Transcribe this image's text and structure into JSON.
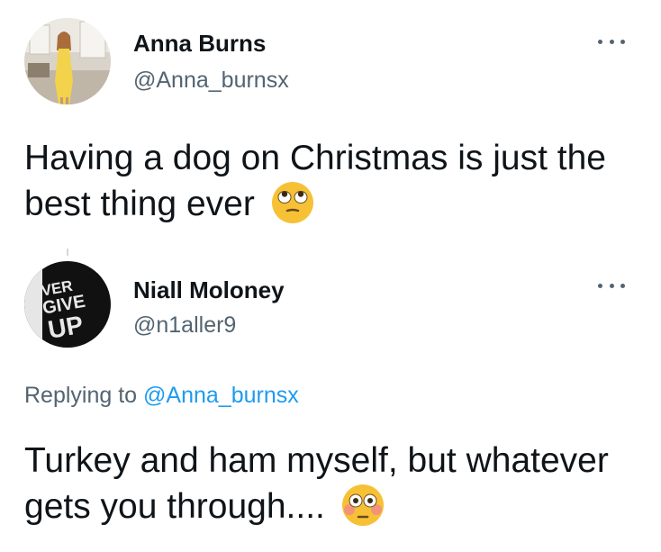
{
  "tweet1": {
    "author": {
      "name": "Anna Burns",
      "handle": "@Anna_burnsx",
      "avatar_icon": "profile-photo-woman-yellow-dress"
    },
    "more_icon": "more-options-icon",
    "text": "Having a dog on Christmas is just the best thing ever",
    "emoji_icon": "rolling-eyes-face-emoji"
  },
  "tweet2": {
    "author": {
      "name": "Niall Moloney",
      "handle": "@n1aller9",
      "avatar_icon": "profile-photo-never-give-up-shirt",
      "avatar_text": "NEVER GIVE UP"
    },
    "more_icon": "more-options-icon",
    "replying_prefix": "Replying to",
    "replying_handle": "@Anna_burnsx",
    "text": "Turkey and ham myself, but whatever gets you through....",
    "emoji_icon": "flushed-face-emoji"
  },
  "colors": {
    "text_primary": "#0f1419",
    "text_secondary": "#536471",
    "link": "#1d9bf0",
    "emoji_yellow": "#f7c136"
  }
}
